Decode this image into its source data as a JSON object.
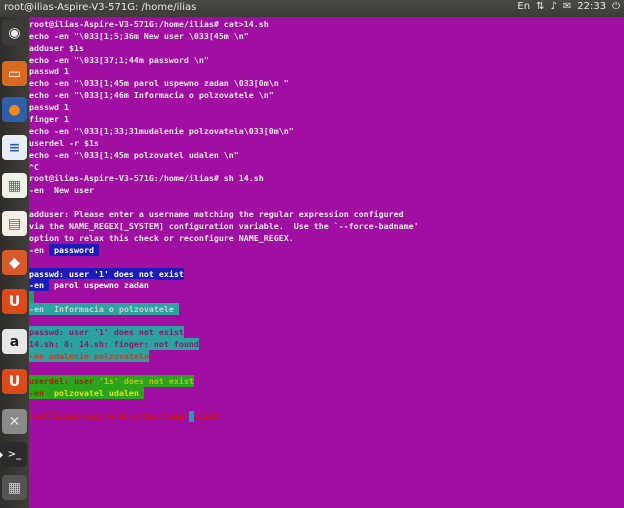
{
  "window": {
    "title": "root@ilias-Aspire-V3-571G: /home/ilias",
    "tray": {
      "keyboard": "En",
      "volume": "♪",
      "clock": "22:33"
    }
  },
  "launcher": {
    "items": [
      {
        "name": "dash-home-icon",
        "glyph": "◉",
        "bg": "#3b3a36",
        "fg": "#eeeeee"
      },
      {
        "name": "files-icon",
        "glyph": "▭",
        "bg": "#d9691f",
        "fg": "#ffffff"
      },
      {
        "name": "firefox-icon",
        "glyph": "●",
        "bg": "#2e5fa8",
        "fg": "#f08a1c"
      },
      {
        "name": "writer-icon",
        "glyph": "≡",
        "bg": "#e8eef7",
        "fg": "#2b5ea7"
      },
      {
        "name": "calc-icon",
        "glyph": "▦",
        "bg": "#eef4ea",
        "fg": "#2f8a2f"
      },
      {
        "name": "impress-icon",
        "glyph": "▤",
        "bg": "#f6efe5",
        "fg": "#c4531d"
      },
      {
        "name": "software-center-icon",
        "glyph": "◆",
        "bg": "#d8592a",
        "fg": "#ffffff"
      },
      {
        "name": "ubuntu-one-icon",
        "glyph": "U",
        "bg": "#dc4a1c",
        "fg": "#ffffff"
      },
      {
        "name": "amazon-icon",
        "glyph": "a",
        "bg": "#e6e6e6",
        "fg": "#222222"
      },
      {
        "name": "ubuntu-one-music-icon",
        "glyph": "U",
        "bg": "#dc4a1c",
        "fg": "#ffffff"
      },
      {
        "name": "settings-icon",
        "glyph": "✕",
        "bg": "#8a8a8a",
        "fg": "#e0e0e0"
      },
      {
        "name": "terminal-icon",
        "glyph": ">_",
        "bg": "#2b2b2b",
        "fg": "#dddddd"
      },
      {
        "name": "workspace-switcher-icon",
        "glyph": "▦",
        "bg": "#555555",
        "fg": "#cccccc"
      }
    ]
  },
  "terminal": {
    "lines": [
      {
        "segs": [
          {
            "t": "root@ilias-Aspire-V3-571G:/home/ilias# cat>14.sh"
          }
        ]
      },
      {
        "segs": [
          {
            "t": "echo -en \"\\033[1;5;36m New user \\033[45m \\n\""
          }
        ]
      },
      {
        "segs": [
          {
            "t": "adduser $1s"
          }
        ]
      },
      {
        "segs": [
          {
            "t": "echo -en \"\\033[37;1;44m password \\n\""
          }
        ]
      },
      {
        "segs": [
          {
            "t": "passwd 1"
          }
        ]
      },
      {
        "segs": [
          {
            "t": "echo -en \"\\033[1;45m parol uspewno zadan \\033[0m\\n \""
          }
        ]
      },
      {
        "segs": [
          {
            "t": "echo -en \"\\033[1;46m Informacia o polzovatele \\n\""
          }
        ]
      },
      {
        "segs": [
          {
            "t": "passwd 1"
          }
        ]
      },
      {
        "segs": [
          {
            "t": "finger 1"
          }
        ]
      },
      {
        "segs": [
          {
            "t": "echo -en \"\\033[1;33;31mudalenie polzovatela\\033[0m\\n\""
          }
        ]
      },
      {
        "segs": [
          {
            "t": "userdel -r $1s"
          }
        ]
      },
      {
        "segs": [
          {
            "t": "echo -en \"\\033[1;45m polzovatel udalen \\n\""
          }
        ]
      },
      {
        "segs": [
          {
            "t": "^C"
          }
        ]
      },
      {
        "segs": [
          {
            "t": "root@ilias-Aspire-V3-571G:/home/ilias# sh 14.sh"
          }
        ]
      },
      {
        "segs": [
          {
            "t": "-en  New user"
          }
        ]
      },
      {
        "segs": [
          {
            "t": ""
          }
        ]
      },
      {
        "segs": [
          {
            "t": "adduser: Please enter a username matching the regular expression configured"
          }
        ]
      },
      {
        "segs": [
          {
            "t": "via the NAME_REGEX[_SYSTEM] configuration variable.  Use the `--force-badname'"
          }
        ]
      },
      {
        "segs": [
          {
            "t": "option to relax this check or reconfigure NAME_REGEX."
          }
        ]
      },
      {
        "segs": [
          {
            "t": "-en "
          },
          {
            "t": " password ",
            "bg": "#1c1cb8",
            "fg": "#ffffff"
          }
        ]
      },
      {
        "segs": [
          {
            "t": ""
          }
        ]
      },
      {
        "segs": [
          {
            "t": "passwd: user '1' does not exist",
            "bg": "#1c1cb8",
            "fg": "#ffffff"
          }
        ]
      },
      {
        "segs": [
          {
            "t": "-en ",
            "bg": "#1c1cb8",
            "fg": "#ffffff"
          },
          {
            "t": " parol uspewno zadan ",
            "bg": "#a10fa2",
            "fg": "#ffffff"
          }
        ]
      },
      {
        "segs": [
          {
            "t": " ",
            "bg": "#1ea06e"
          }
        ]
      },
      {
        "segs": [
          {
            "t": "-en  Informacia o polzovatele ",
            "bg": "#2ba3a0",
            "fg": "#cfcfcf"
          }
        ]
      },
      {
        "segs": [
          {
            "t": ""
          }
        ]
      },
      {
        "segs": [
          {
            "t": "passwd: user '1' does not exist",
            "bg": "#2ba3a0",
            "fg": "#8a1a6a"
          }
        ]
      },
      {
        "segs": [
          {
            "t": "14.sh: 8: 14.sh: finger: not found",
            "bg": "#2ba3a0",
            "fg": "#8a1a6a"
          }
        ]
      },
      {
        "segs": [
          {
            "t": "-en udalenie polzovatela",
            "bg": "#2ba3a0",
            "fg": "#c2402a"
          }
        ]
      },
      {
        "segs": [
          {
            "t": ""
          }
        ]
      },
      {
        "segs": [
          {
            "t": "userdel: user ",
            "bg": "#2aa51c",
            "fg": "#b21810"
          },
          {
            "t": "'1s' does not exist",
            "bg": "#2aa51c",
            "fg": "#c0c020"
          }
        ]
      },
      {
        "segs": [
          {
            "t": "-en ",
            "bg": "#2aa51c",
            "fg": "#b21810"
          },
          {
            "t": " polzovatel udalen ",
            "bg": "#2aa51c",
            "fg": "#e0e020"
          }
        ]
      },
      {
        "segs": [
          {
            "t": ""
          }
        ]
      },
      {
        "segs": [
          {
            "t": "root@ilias-Aspire-V3-571G:/home/ilias# ",
            "fg": "#d01818"
          }
        ]
      }
    ]
  }
}
